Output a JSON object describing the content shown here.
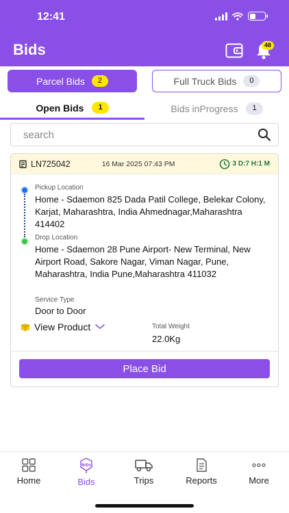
{
  "status_bar": {
    "time": "12:41"
  },
  "header": {
    "title": "Bids",
    "notification_count": "48"
  },
  "bid_types": [
    {
      "label": "Parcel Bids",
      "count": "2"
    },
    {
      "label": "Full Truck Bids",
      "count": "0"
    }
  ],
  "sub_tabs": [
    {
      "label": "Open Bids",
      "count": "1"
    },
    {
      "label": "Bids inProgress",
      "count": "1"
    }
  ],
  "search": {
    "placeholder": "search"
  },
  "bid_card": {
    "lr_number": "LN725042",
    "date": "16 Mar 2025 07:43 PM",
    "time_left": "3 D:7 H:1 M",
    "pickup_label": "Pickup Location",
    "pickup_address": "Home - Sdaemon 825 Dada Patil College, Belekar Colony, Karjat, Maharashtra, India Ahmednagar,Maharashtra 414402",
    "drop_label": "Drop Location",
    "drop_address": "Home - Sdaemon 28 Pune Airport- New Terminal, New Airport Road, Sakore Nagar, Viman Nagar, Pune, Maharashtra, India Pune,Maharashtra 411032",
    "service_label": "Service Type",
    "service_value": "Door to Door",
    "view_product_label": "View Product",
    "weight_label": "Total Weight",
    "weight_value": "22.0Kg",
    "place_bid_label": "Place Bid"
  },
  "bottom_nav": [
    {
      "label": "Home",
      "icon": "grid-icon"
    },
    {
      "label": "Bids",
      "icon": "bids-icon"
    },
    {
      "label": "Trips",
      "icon": "truck-icon"
    },
    {
      "label": "Reports",
      "icon": "document-icon"
    },
    {
      "label": "More",
      "icon": "more-dots-icon"
    }
  ],
  "colors": {
    "primary": "#8a4fe6",
    "badge_yellow": "#ffe600",
    "timer_green": "#1f7a3a"
  }
}
